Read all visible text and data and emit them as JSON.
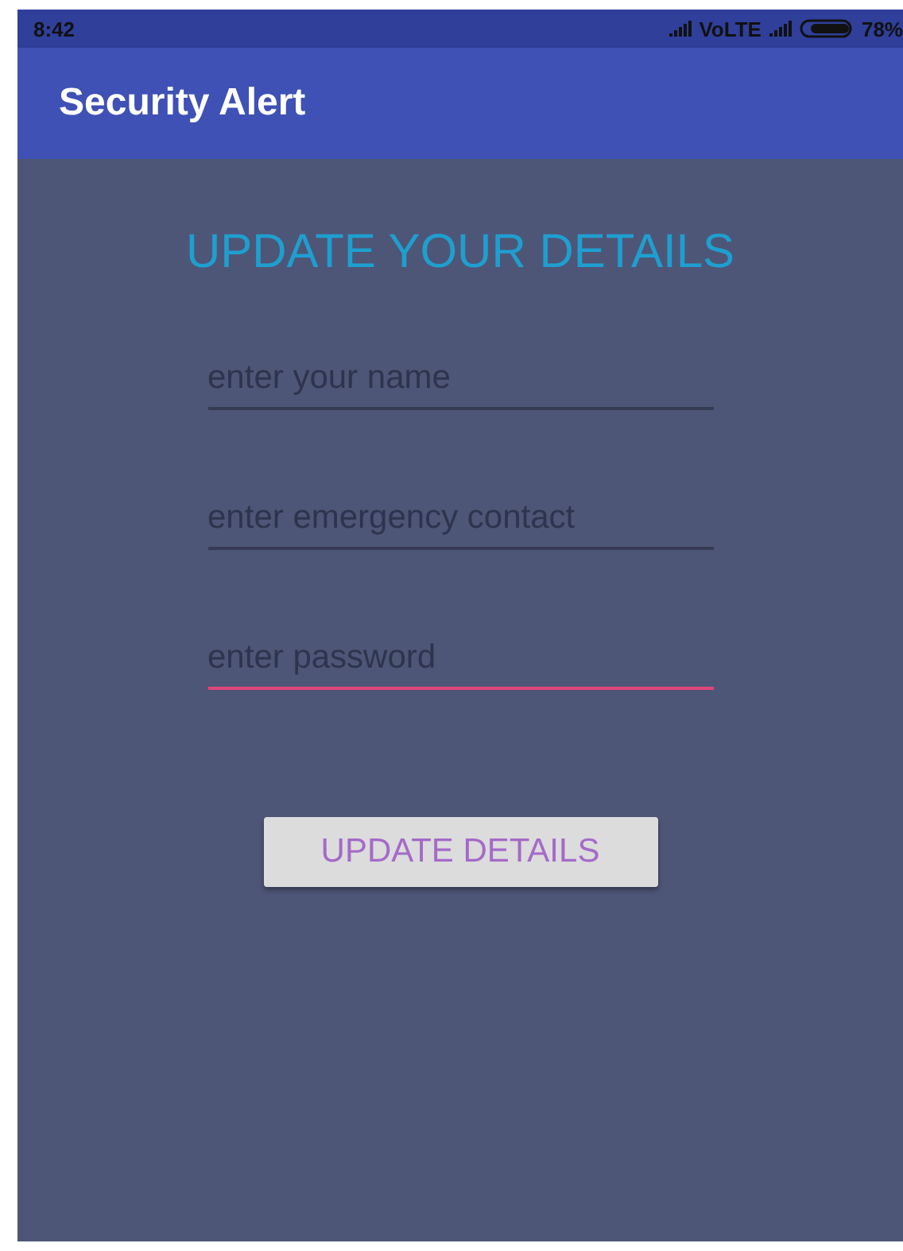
{
  "status_bar": {
    "time": "8:42",
    "network": "VoLTE",
    "battery": "78%"
  },
  "app_bar": {
    "title": "Security Alert"
  },
  "heading": "UPDATE YOUR DETAILS",
  "fields": [
    {
      "placeholder": "enter your name",
      "focused": false
    },
    {
      "placeholder": "enter emergency contact",
      "focused": false
    },
    {
      "placeholder": "enter password",
      "focused": true
    }
  ],
  "button": "UPDATE DETAILS"
}
